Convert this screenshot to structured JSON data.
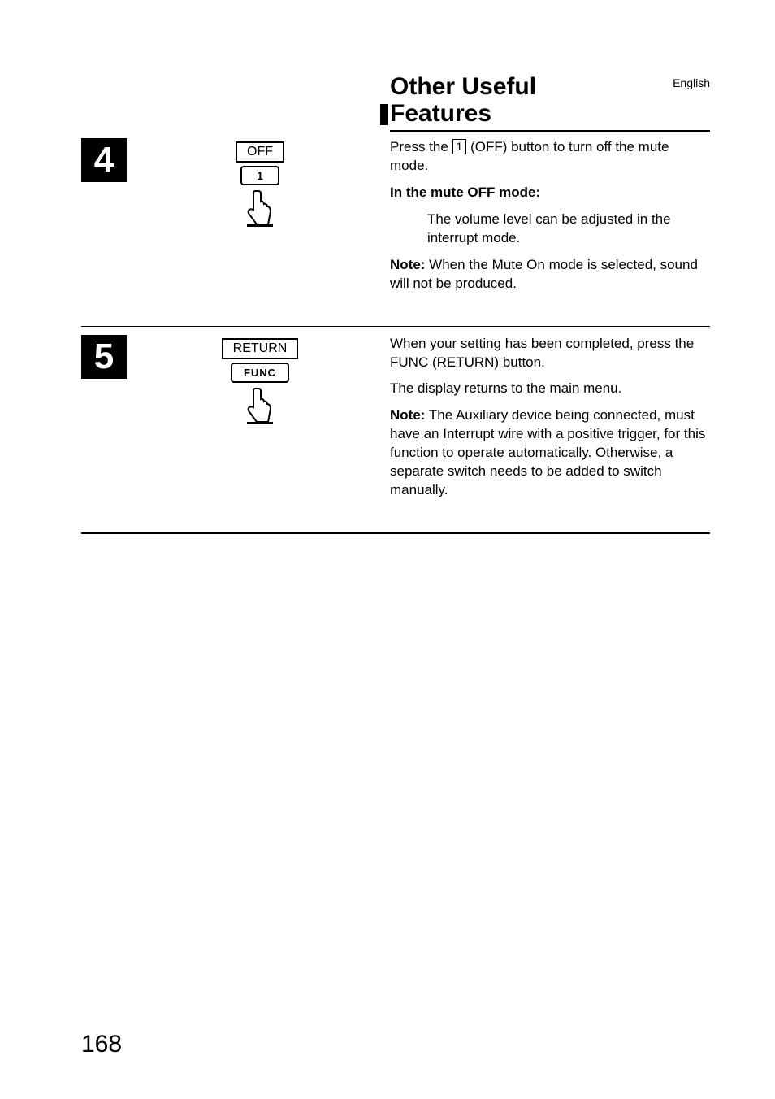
{
  "header": {
    "title_line1": "Other Useful",
    "title_line2": "Features",
    "language": "English"
  },
  "steps": [
    {
      "number": "4",
      "illust_label": "OFF",
      "illust_button": "1",
      "text": {
        "p1_before_key": "Press the ",
        "p1_key": "1",
        "p1_after_key": " (OFF) button to turn off the mute mode.",
        "sub_heading": "In the mute OFF mode:",
        "sub_body": "The volume level can be adjusted in the interrupt mode.",
        "note_label": "Note:",
        "note_body": " When the Mute On mode is selected, sound will not be produced."
      }
    },
    {
      "number": "5",
      "illust_label": "RETURN",
      "illust_button": "FUNC",
      "text": {
        "p1": "When your setting has been completed, press the FUNC (RETURN) button.",
        "p2": "The display returns to the main menu.",
        "note_label": "Note:",
        "note_body": " The Auxiliary device being connected, must have an Interrupt wire with a positive trigger, for this function to operate automatically. Otherwise, a separate switch needs to be added to switch manually."
      }
    }
  ],
  "page_number": "168"
}
